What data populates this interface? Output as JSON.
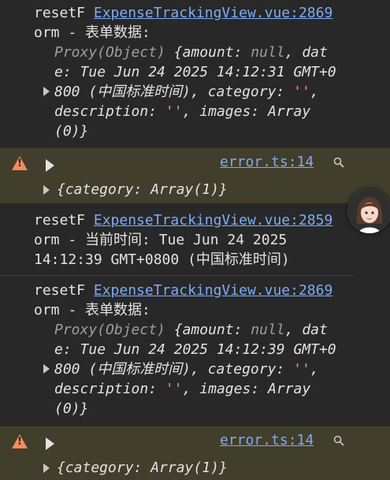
{
  "log1": {
    "prefix": "resetF",
    "link": "ExpenseTrackingView.vue:2869",
    "line2": "orm - 表单数据:",
    "proxy": "Proxy(Object)",
    "obj_l1_open": " {",
    "amount_key": "amount",
    "amount_val": "null",
    "date_key_part1": "dat",
    "date_key_part2": "e",
    "date_val_l2": " Tue Jun 24 2025 14:12:31 GMT+0",
    "date_val_l3": "800 (中国标准时间)",
    "category_key": "category",
    "category_val": "''",
    "description_key": "description",
    "description_val": "''",
    "images_key": "images",
    "images_val": "Array",
    "last": "(0)}"
  },
  "warn1": {
    "file_link": "error.ts:14",
    "detail": "{category: Array(1)}"
  },
  "log2": {
    "prefix": "resetF",
    "link": "ExpenseTrackingView.vue:2859",
    "line2": "orm - 当前时间: Tue Jun 24 2025",
    "line3": "14:12:39 GMT+0800 (中国标准时间)"
  },
  "log3": {
    "prefix": "resetF",
    "link": "ExpenseTrackingView.vue:2869",
    "line2": "orm - 表单数据:",
    "proxy": "Proxy(Object)",
    "amount_key": "amount",
    "amount_val": "null",
    "date_val_l2": " Tue Jun 24 2025 14:12:39 GMT+0",
    "date_val_l3": "800 (中国标准时间)",
    "category_key": "category",
    "category_val": "''",
    "description_key": "description",
    "description_val": "''",
    "images_key": "images",
    "images_val": "Array",
    "last": "(0)}"
  },
  "warn2": {
    "file_link": "error.ts:14",
    "detail": "{category: Array(1)}"
  },
  "icons": {
    "warning": "warning-icon",
    "expand": "expand-arrow-icon",
    "search": "search-icon",
    "avatar": "avatar-icon"
  }
}
